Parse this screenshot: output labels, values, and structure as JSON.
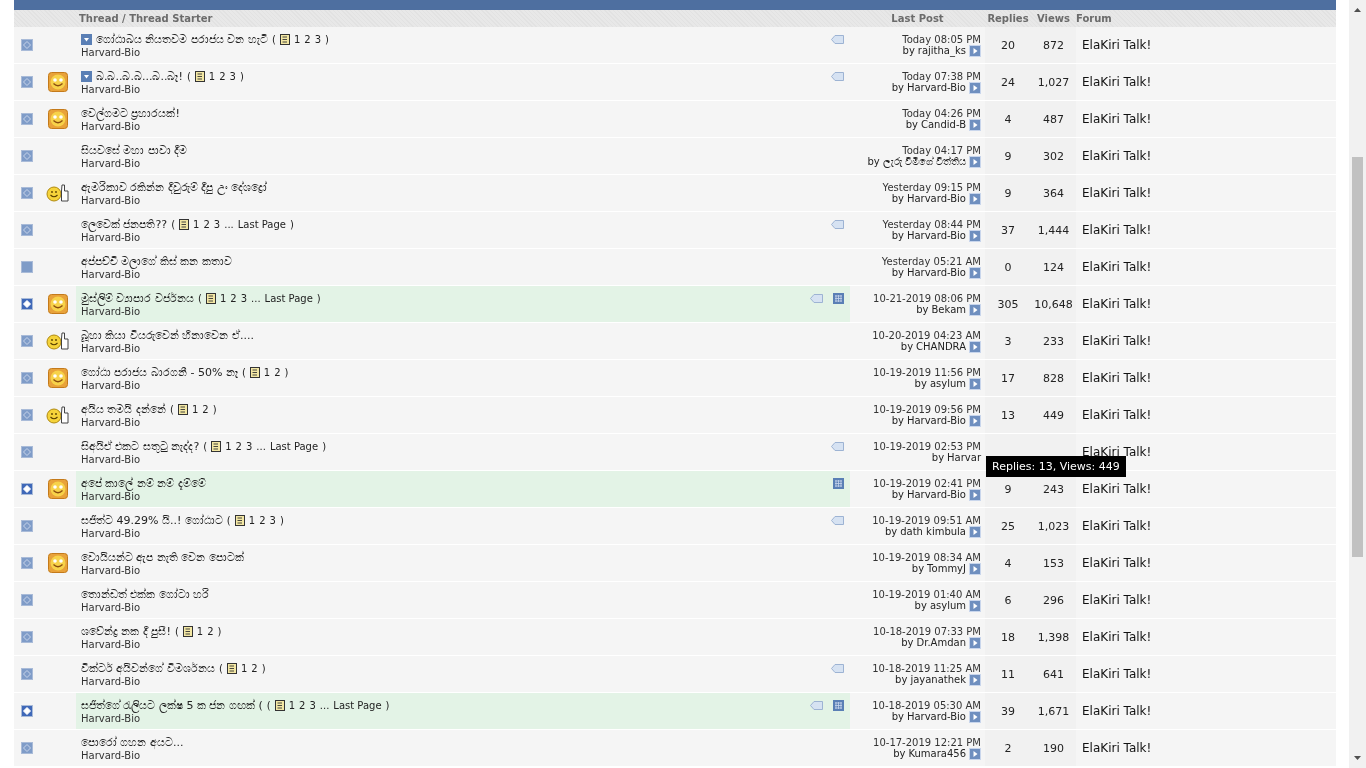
{
  "columns": {
    "thread": "Thread / Thread Starter",
    "last_post": "Last Post",
    "replies": "Replies",
    "views": "Views",
    "forum": "Forum"
  },
  "rows": [
    {
      "emblem": true,
      "new_posts": false,
      "kind": "plain",
      "prefix": true,
      "title": "ගෝඨාබය නියතවම පරාජය වන හැටි",
      "pages": {
        "open": "(",
        "numbers": [
          "1",
          "2",
          "3"
        ],
        "close": ")"
      },
      "starter": "Harvard-Bio",
      "tagged": true,
      "gallery": false,
      "highlighted": false,
      "last_date": "Today 08:05 PM",
      "by": "by",
      "last_by": "rajitha_ks",
      "replies": "20",
      "views": "872",
      "forum": "ElaKiri Talk!"
    },
    {
      "emblem": true,
      "new_posts": false,
      "kind": "smiley",
      "prefix": true,
      "title": "බ.බ..බ.බ...බ..බෑ!",
      "pages": {
        "open": "(",
        "numbers": [
          "1",
          "2",
          "3"
        ],
        "close": ")"
      },
      "starter": "Harvard-Bio",
      "tagged": true,
      "gallery": false,
      "highlighted": false,
      "last_date": "Today 07:38 PM",
      "by": "by",
      "last_by": "Harvard-Bio",
      "replies": "24",
      "views": "1,027",
      "forum": "ElaKiri Talk!"
    },
    {
      "emblem": true,
      "new_posts": false,
      "kind": "smiley",
      "prefix": false,
      "title": "වෙල්ගමට ප්‍රහාරයක්!",
      "starter": "Harvard-Bio",
      "tagged": false,
      "gallery": false,
      "highlighted": false,
      "last_date": "Today 04:26 PM",
      "by": "by",
      "last_by": "Candid-B",
      "replies": "4",
      "views": "487",
      "forum": "ElaKiri Talk!"
    },
    {
      "emblem": true,
      "new_posts": false,
      "kind": "plain",
      "prefix": false,
      "title": "සියවසේ මහා පාවා දීම",
      "starter": "Harvard-Bio",
      "tagged": false,
      "gallery": false,
      "highlighted": false,
      "last_date": "Today 04:17 PM",
      "by": "by",
      "last_by": "ලැරු විමිගේ විත්තිය",
      "replies": "9",
      "views": "302",
      "forum": "ElaKiri Talk!"
    },
    {
      "emblem": true,
      "new_posts": false,
      "kind": "thumbs",
      "prefix": false,
      "title": "ඇමරිකාව රකින්න දිවුරුම් දීපු උං දේශද්‍රෝ",
      "starter": "Harvard-Bio",
      "tagged": false,
      "gallery": false,
      "highlighted": false,
      "last_date": "Yesterday 09:15 PM",
      "by": "by",
      "last_by": "Harvard-Bio",
      "replies": "9",
      "views": "364",
      "forum": "ElaKiri Talk!"
    },
    {
      "emblem": true,
      "new_posts": false,
      "kind": "plain",
      "prefix": false,
      "title": "ලෙවෙක් ජනපති??",
      "pages": {
        "open": "(",
        "numbers": [
          "1",
          "2",
          "3"
        ],
        "gap": "...",
        "last": "Last Page",
        "close": ")"
      },
      "starter": "Harvard-Bio",
      "tagged": true,
      "gallery": false,
      "highlighted": false,
      "last_date": "Yesterday 08:44 PM",
      "by": "by",
      "last_by": "Harvard-Bio",
      "replies": "37",
      "views": "1,444",
      "forum": "ElaKiri Talk!"
    },
    {
      "emblem": false,
      "new_posts": false,
      "kind": "plain",
      "prefix": false,
      "title": "අප්පච්චි මලාගේ කිස් කන කතාව",
      "starter": "Harvard-Bio",
      "tagged": false,
      "gallery": false,
      "highlighted": false,
      "last_date": "Yesterday 05:21 AM",
      "by": "by",
      "last_by": "Harvard-Bio",
      "replies": "0",
      "views": "124",
      "forum": "ElaKiri Talk!"
    },
    {
      "emblem": true,
      "new_posts": true,
      "kind": "smiley",
      "prefix": false,
      "title": "මුස්ලිම් ව්‍යාපාර වර්ජනය",
      "pages": {
        "open": "(",
        "numbers": [
          "1",
          "2",
          "3"
        ],
        "gap": "...",
        "last": "Last Page",
        "close": ")"
      },
      "starter": "Harvard-Bio",
      "tagged": true,
      "gallery": true,
      "highlighted": true,
      "last_date": "10-21-2019 08:06 PM",
      "by": "by",
      "last_by": "Bekam",
      "replies": "305",
      "views": "10,648",
      "forum": "ElaKiri Talk!"
    },
    {
      "emblem": true,
      "new_posts": false,
      "kind": "thumbs",
      "prefix": false,
      "title": "බූහා කියා වියරුවෙන් හිනාවෙන ඒ....",
      "starter": "Harvard-Bio",
      "tagged": false,
      "gallery": false,
      "highlighted": false,
      "last_date": "10-20-2019 04:23 AM",
      "by": "by",
      "last_by": "CHANDRA",
      "replies": "3",
      "views": "233",
      "forum": "ElaKiri Talk!"
    },
    {
      "emblem": true,
      "new_posts": false,
      "kind": "smiley",
      "prefix": false,
      "title": "ගෝඨා පරාජය බාරගනී - 50% නෑ",
      "pages": {
        "open": "(",
        "numbers": [
          "1",
          "2"
        ],
        "close": ")"
      },
      "starter": "Harvard-Bio",
      "tagged": false,
      "gallery": false,
      "highlighted": false,
      "last_date": "10-19-2019 11:56 PM",
      "by": "by",
      "last_by": "asylum",
      "replies": "17",
      "views": "828",
      "forum": "ElaKiri Talk!"
    },
    {
      "emblem": true,
      "new_posts": false,
      "kind": "thumbs",
      "prefix": false,
      "title": "අයිය තමයි දන්නේ",
      "pages": {
        "open": "(",
        "numbers": [
          "1",
          "2"
        ],
        "close": ")"
      },
      "starter": "Harvard-Bio",
      "tagged": false,
      "gallery": false,
      "highlighted": false,
      "last_date": "10-19-2019 09:56 PM",
      "by": "by",
      "last_by": "Harvard-Bio",
      "replies": "13",
      "views": "449",
      "forum": "ElaKiri Talk!"
    },
    {
      "emblem": true,
      "new_posts": false,
      "kind": "plain",
      "prefix": false,
      "title": "සිඅයිඒ එකට සතුටු නැද්ද?",
      "pages": {
        "open": "(",
        "numbers": [
          "1",
          "2",
          "3"
        ],
        "gap": "...",
        "last": "Last Page",
        "close": ")"
      },
      "starter": "Harvard-Bio",
      "tagged": true,
      "gallery": false,
      "highlighted": false,
      "last_date": "10-19-2019 02:53 PM",
      "by": "by",
      "last_by": "Harvar",
      "forum": "ElaKiri Talk!",
      "tooltip": "Replies: 13, Views: 449"
    },
    {
      "emblem": true,
      "new_posts": true,
      "kind": "smiley",
      "prefix": false,
      "title": "අපේ කාලේ නම් නම් දැම්මේ",
      "starter": "Harvard-Bio",
      "tagged": false,
      "gallery": true,
      "highlighted": true,
      "last_date": "10-19-2019 02:41 PM",
      "by": "by",
      "last_by": "Harvard-Bio",
      "replies": "9",
      "views": "243",
      "forum": "ElaKiri Talk!"
    },
    {
      "emblem": true,
      "new_posts": false,
      "kind": "plain",
      "prefix": false,
      "title": "සජිත්ට 49.29% යි..! ගෝඨාට",
      "pages": {
        "open": "(",
        "numbers": [
          "1",
          "2",
          "3"
        ],
        "close": ")"
      },
      "starter": "Harvard-Bio",
      "tagged": true,
      "gallery": false,
      "highlighted": false,
      "last_date": "10-19-2019 09:51 AM",
      "by": "by",
      "last_by": "dath kimbula",
      "replies": "25",
      "views": "1,023",
      "forum": "ElaKiri Talk!"
    },
    {
      "emblem": true,
      "new_posts": false,
      "kind": "smiley",
      "prefix": false,
      "title": "වොයියන්ට ඇප නැති වෙන පොටක්",
      "starter": "Harvard-Bio",
      "tagged": false,
      "gallery": false,
      "highlighted": false,
      "last_date": "10-19-2019 08:34 AM",
      "by": "by",
      "last_by": "TommyJ",
      "replies": "4",
      "views": "153",
      "forum": "ElaKiri Talk!"
    },
    {
      "emblem": true,
      "new_posts": false,
      "kind": "plain",
      "prefix": false,
      "title": "තොන්ඩත් එක්ක ගෝටා හරි",
      "starter": "Harvard-Bio",
      "tagged": false,
      "gallery": false,
      "highlighted": false,
      "last_date": "10-19-2019 01:40 AM",
      "by": "by",
      "last_by": "asylum",
      "replies": "6",
      "views": "296",
      "forum": "ElaKiri Talk!"
    },
    {
      "emblem": true,
      "new_posts": false,
      "kind": "plain",
      "prefix": false,
      "title": "ශවේන්ද්‍ර නක දී පුසී!",
      "pages": {
        "open": "(",
        "numbers": [
          "1",
          "2"
        ],
        "close": ")"
      },
      "starter": "Harvard-Bio",
      "tagged": false,
      "gallery": false,
      "highlighted": false,
      "last_date": "10-18-2019 07:33 PM",
      "by": "by",
      "last_by": "Dr.Amdan",
      "replies": "18",
      "views": "1,398",
      "forum": "ElaKiri Talk!"
    },
    {
      "emblem": true,
      "new_posts": false,
      "kind": "plain",
      "prefix": false,
      "title": "වික්ටර් අයිවන්ගේ විමර්ශනය",
      "pages": {
        "open": "(",
        "numbers": [
          "1",
          "2"
        ],
        "close": ")"
      },
      "starter": "Harvard-Bio",
      "tagged": true,
      "gallery": false,
      "highlighted": false,
      "last_date": "10-18-2019 11:25 AM",
      "by": "by",
      "last_by": "jayanathek",
      "replies": "11",
      "views": "641",
      "forum": "ElaKiri Talk!"
    },
    {
      "emblem": true,
      "new_posts": true,
      "kind": "plain",
      "prefix": false,
      "title": "සජිත්ගේ රැලියට ලක්ෂ 5 ක ජන ගඟක් (",
      "pages": {
        "open": "(",
        "numbers": [
          "1",
          "2",
          "3"
        ],
        "gap": "...",
        "last": "Last Page",
        "close": ")"
      },
      "starter": "Harvard-Bio",
      "tagged": true,
      "gallery": true,
      "highlighted": true,
      "last_date": "10-18-2019 05:30 AM",
      "by": "by",
      "last_by": "Harvard-Bio",
      "replies": "39",
      "views": "1,671",
      "forum": "ElaKiri Talk!"
    },
    {
      "emblem": true,
      "new_posts": false,
      "kind": "plain",
      "prefix": false,
      "title": "පොරෝ ගහන අයට...",
      "starter": "Harvard-Bio",
      "tagged": false,
      "gallery": false,
      "highlighted": false,
      "last_date": "10-17-2019 12:21 PM",
      "by": "by",
      "last_by": "Kumara456",
      "replies": "2",
      "views": "190",
      "forum": "ElaKiri Talk!"
    }
  ]
}
